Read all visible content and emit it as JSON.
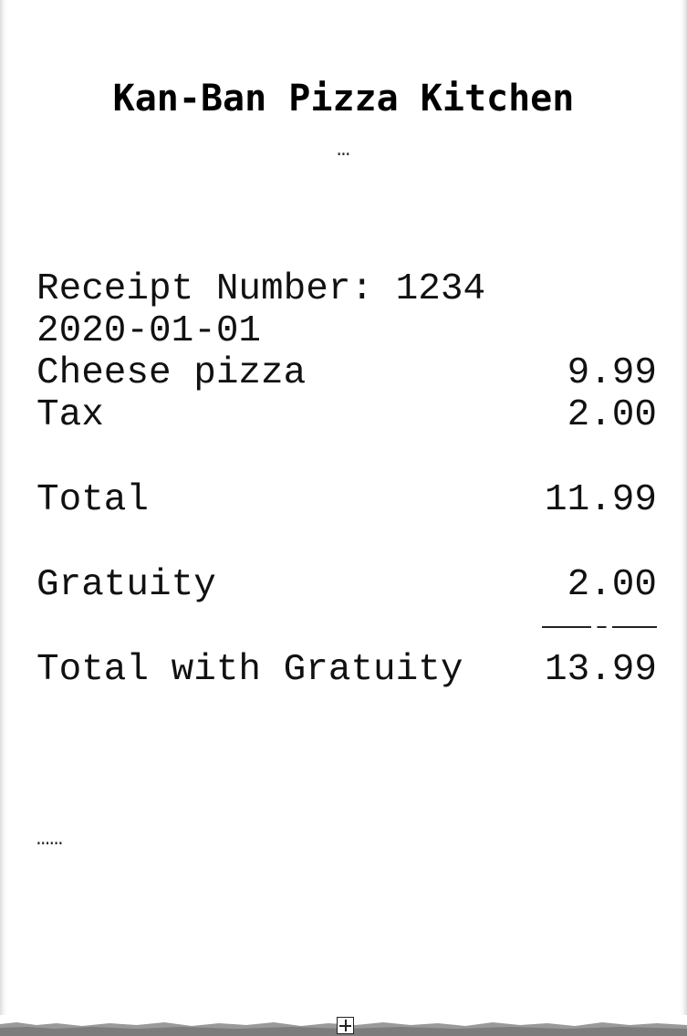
{
  "receipt": {
    "restaurant_name": "Kan-Ban Pizza Kitchen",
    "top_ellipsis": "…",
    "receipt_number_line": "Receipt Number: 1234",
    "date": "2020-01-01",
    "items": [
      {
        "label": "Cheese pizza",
        "amount": "9.99"
      },
      {
        "label": "Tax",
        "amount": "2.00"
      }
    ],
    "total": {
      "label": "Total",
      "amount": "11.99"
    },
    "gratuity": {
      "label": "Gratuity",
      "amount": "2.00"
    },
    "total_with_gratuity": {
      "label": "Total with Gratuity",
      "amount": "13.99"
    },
    "bottom_ellipsis": "……"
  },
  "icons": {
    "expand": "expand-plus-icon"
  },
  "colors": {
    "paper": "#ffffff",
    "ink": "#111111"
  }
}
